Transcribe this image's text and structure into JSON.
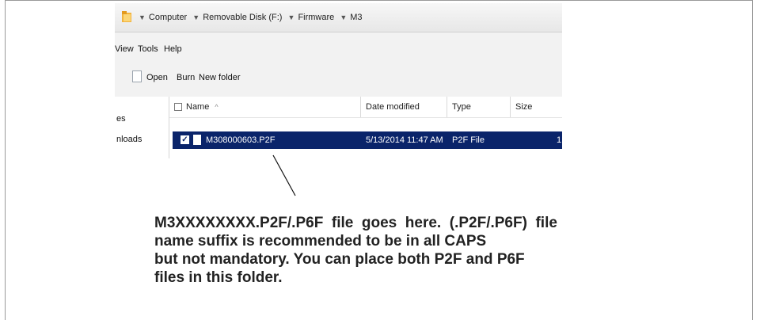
{
  "address_bar": {
    "crumbs": [
      "Computer",
      "Removable Disk (F:)",
      "Firmware",
      "M3"
    ]
  },
  "menu": {
    "view": "View",
    "tools": "Tools",
    "help": "Help"
  },
  "toolbar": {
    "open": "Open",
    "burn": "Burn",
    "new_folder": "New folder"
  },
  "nav_pane": {
    "item1": "es",
    "item2": "nloads"
  },
  "file_list": {
    "columns": {
      "name": "Name",
      "sort_indicator": "^",
      "date": "Date modified",
      "type": "Type",
      "size": "Size"
    },
    "rows": [
      {
        "name": "M308000603.P2F",
        "date": "5/13/2014 11:47 AM",
        "type": "P2F File",
        "size": "1"
      }
    ]
  },
  "caption": {
    "line1": "M3XXXXXXXX.P2F/.P6F  file  goes  here.  (.P2F/.P6F)  file",
    "line2": "name suffix is recommended to be in all CAPS",
    "line3": "but not mandatory. You can place both P2F and P6F",
    "line4": "files in this folder."
  },
  "colors": {
    "selection": "#0a246a",
    "folder": "#f2b33d",
    "caption_text": "#222222"
  }
}
